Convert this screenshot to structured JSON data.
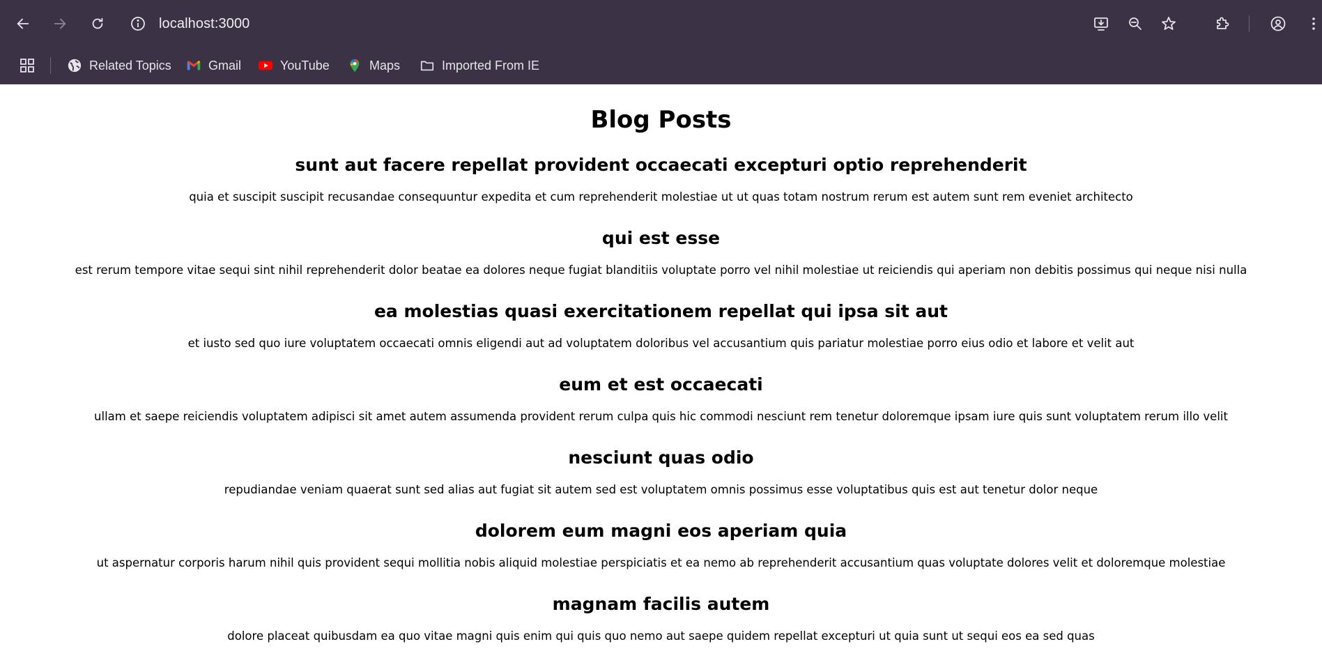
{
  "browser": {
    "url": "localhost:3000",
    "bookmarks": [
      {
        "label": "Related Topics",
        "icon": "globe-icon"
      },
      {
        "label": "Gmail",
        "icon": "gmail-icon"
      },
      {
        "label": "YouTube",
        "icon": "youtube-icon"
      },
      {
        "label": "Maps",
        "icon": "maps-icon"
      },
      {
        "label": "Imported From IE",
        "icon": "folder-icon"
      }
    ],
    "colors": {
      "chrome_bg": "#3c3245",
      "icon": "#e8e4ec"
    }
  },
  "page": {
    "title": "Blog Posts",
    "posts": [
      {
        "title": "sunt aut facere repellat provident occaecati excepturi optio reprehenderit",
        "body": "quia et suscipit suscipit recusandae consequuntur expedita et cum reprehenderit molestiae ut ut quas totam nostrum rerum est autem sunt rem eveniet architecto"
      },
      {
        "title": "qui est esse",
        "body": "est rerum tempore vitae sequi sint nihil reprehenderit dolor beatae ea dolores neque fugiat blanditiis voluptate porro vel nihil molestiae ut reiciendis qui aperiam non debitis possimus qui neque nisi nulla"
      },
      {
        "title": "ea molestias quasi exercitationem repellat qui ipsa sit aut",
        "body": "et iusto sed quo iure voluptatem occaecati omnis eligendi aut ad voluptatem doloribus vel accusantium quis pariatur molestiae porro eius odio et labore et velit aut"
      },
      {
        "title": "eum et est occaecati",
        "body": "ullam et saepe reiciendis voluptatem adipisci sit amet autem assumenda provident rerum culpa quis hic commodi nesciunt rem tenetur doloremque ipsam iure quis sunt voluptatem rerum illo velit"
      },
      {
        "title": "nesciunt quas odio",
        "body": "repudiandae veniam quaerat sunt sed alias aut fugiat sit autem sed est voluptatem omnis possimus esse voluptatibus quis est aut tenetur dolor neque"
      },
      {
        "title": "dolorem eum magni eos aperiam quia",
        "body": "ut aspernatur corporis harum nihil quis provident sequi mollitia nobis aliquid molestiae perspiciatis et ea nemo ab reprehenderit accusantium quas voluptate dolores velit et doloremque molestiae"
      },
      {
        "title": "magnam facilis autem",
        "body": "dolore placeat quibusdam ea quo vitae magni quis enim qui quis quo nemo aut saepe quidem repellat excepturi ut quia sunt ut sequi eos ea sed quas"
      }
    ]
  }
}
